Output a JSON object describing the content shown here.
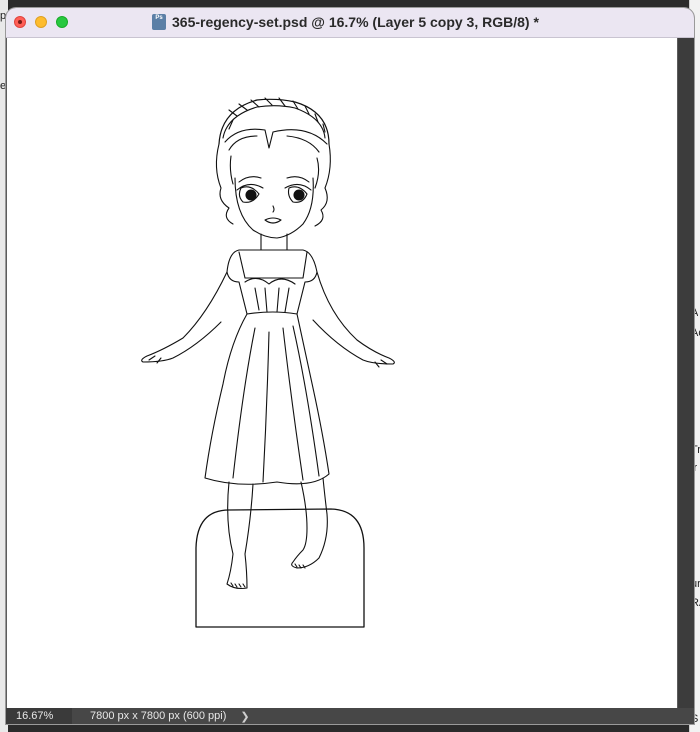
{
  "window": {
    "title": "365-regency-set.psd @ 16.7% (Layer 5 copy 3, RGB/8) *",
    "app_icon": "photoshop-document-icon",
    "app_icon_label": "Ps"
  },
  "status_bar": {
    "zoom": "16.67%",
    "document_info": "7800 px x 7800 px (600 ppi)",
    "expand_icon": "chevron-right-icon",
    "expand_glyph": "❯"
  },
  "background_fragments": {
    "left": [
      "p",
      "e"
    ],
    "right": [
      "A",
      "Ac",
      "Tr",
      "ir",
      "ur",
      "RA",
      "S"
    ]
  },
  "colors": {
    "titlebar": "#ebe6f2",
    "close": "#ff5f57",
    "minimize": "#febc2e",
    "zoom": "#28c840",
    "canvas": "#ffffff",
    "status": "#474747"
  }
}
